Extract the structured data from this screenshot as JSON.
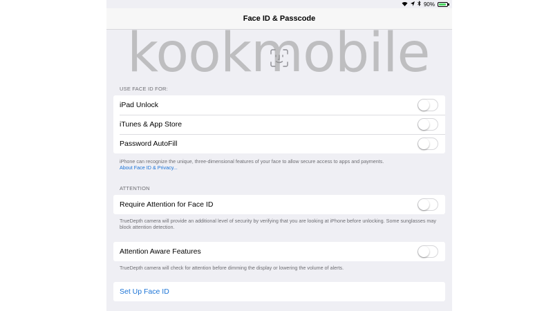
{
  "status_bar": {
    "icons": [
      "wifi-icon",
      "location-icon",
      "bluetooth-icon",
      "battery-icon"
    ],
    "battery_percent": "90%",
    "battery_level": 0.9
  },
  "nav": {
    "title": "Face ID & Passcode"
  },
  "watermark": "kookmobile",
  "use_face_id": {
    "header": "USE FACE ID FOR:",
    "rows": [
      {
        "label": "iPad Unlock",
        "on": false
      },
      {
        "label": "iTunes & App Store",
        "on": false
      },
      {
        "label": "Password AutoFill",
        "on": false
      }
    ],
    "footer_text": "iPhone can recognize the unique, three-dimensional features of your face to allow secure access to apps and payments.",
    "footer_link": "About Face ID & Privacy..."
  },
  "attention": {
    "header": "ATTENTION",
    "require_label": "Require Attention for Face ID",
    "require_on": false,
    "require_footer": "TrueDepth camera will provide an additional level of security by verifying that you are looking at iPhone before unlocking. Some sunglasses may block attention detection.",
    "aware_label": "Attention Aware Features",
    "aware_on": false,
    "aware_footer": "TrueDepth camera will check for attention before dimming the display or lowering the volume of alerts."
  },
  "setup": {
    "label": "Set Up Face ID"
  },
  "colors": {
    "accent": "#1a73d6",
    "background": "#efeff4",
    "battery_fill": "#4cd964"
  }
}
